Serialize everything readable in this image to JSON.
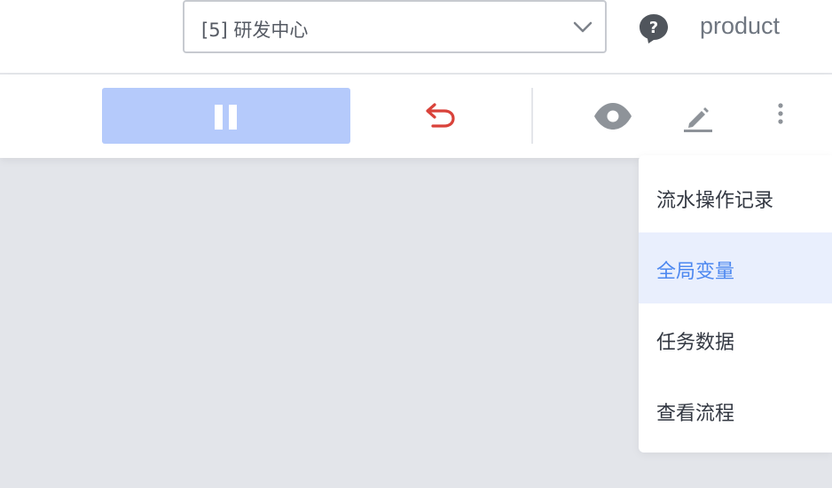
{
  "header": {
    "project_select": {
      "value": "[5] 研发中心"
    },
    "username": "product",
    "icons": {
      "help": "question-bubble-icon",
      "chevron": "chevron-down-icon"
    }
  },
  "toolbar": {
    "buttons": [
      {
        "name": "pause",
        "icon": "pause-icon"
      },
      {
        "name": "undo",
        "icon": "undo-icon"
      },
      {
        "name": "view",
        "icon": "eye-icon"
      },
      {
        "name": "edit",
        "icon": "edit-icon"
      },
      {
        "name": "more",
        "icon": "more-vertical-icon"
      }
    ]
  },
  "dropdown_menu": {
    "items": [
      {
        "label": "流水操作记录"
      },
      {
        "label": "全局变量"
      },
      {
        "label": "任务数据"
      },
      {
        "label": "查看流程"
      }
    ],
    "active_index": 1
  },
  "colors": {
    "primary": "#4d88f0",
    "pause_bg": "#b5cafb",
    "undo": "#d9423a",
    "icon_gray": "#8e9399",
    "canvas_bg": "#e3e5ea"
  }
}
